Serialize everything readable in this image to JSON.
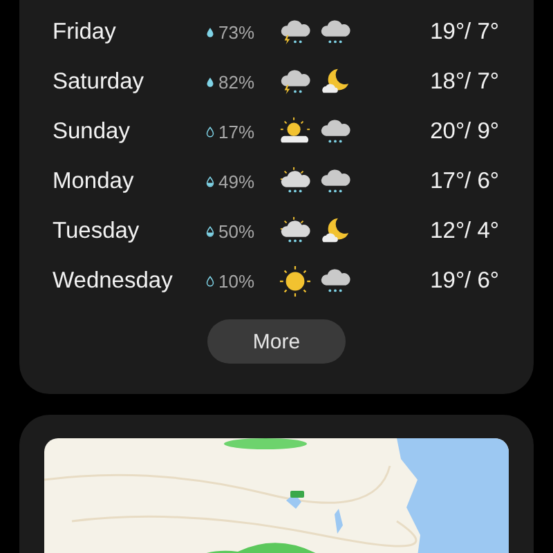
{
  "forecast": [
    {
      "day": "Friday",
      "drop": {
        "kind": "filled"
      },
      "chance": "73%",
      "icons": [
        {
          "kind": "storm"
        },
        {
          "kind": "rain"
        }
      ],
      "temps": "19°/ 7°"
    },
    {
      "day": "Saturday",
      "drop": {
        "kind": "filled"
      },
      "chance": "82%",
      "icons": [
        {
          "kind": "storm"
        },
        {
          "kind": "moon"
        }
      ],
      "temps": "18°/ 7°"
    },
    {
      "day": "Sunday",
      "drop": {
        "kind": "outline"
      },
      "chance": "17%",
      "icons": [
        {
          "kind": "sunrise"
        },
        {
          "kind": "rain"
        }
      ],
      "temps": "20°/ 9°"
    },
    {
      "day": "Monday",
      "drop": {
        "kind": "half"
      },
      "chance": "49%",
      "icons": [
        {
          "kind": "shower"
        },
        {
          "kind": "rain"
        }
      ],
      "temps": "17°/ 6°"
    },
    {
      "day": "Tuesday",
      "drop": {
        "kind": "half"
      },
      "chance": "50%",
      "icons": [
        {
          "kind": "shower"
        },
        {
          "kind": "moon"
        }
      ],
      "temps": "12°/ 4°"
    },
    {
      "day": "Wednesday",
      "drop": {
        "kind": "outline"
      },
      "chance": "10%",
      "icons": [
        {
          "kind": "sun"
        },
        {
          "kind": "rain"
        }
      ],
      "temps": "19°/ 6°"
    }
  ],
  "more_button": "More"
}
